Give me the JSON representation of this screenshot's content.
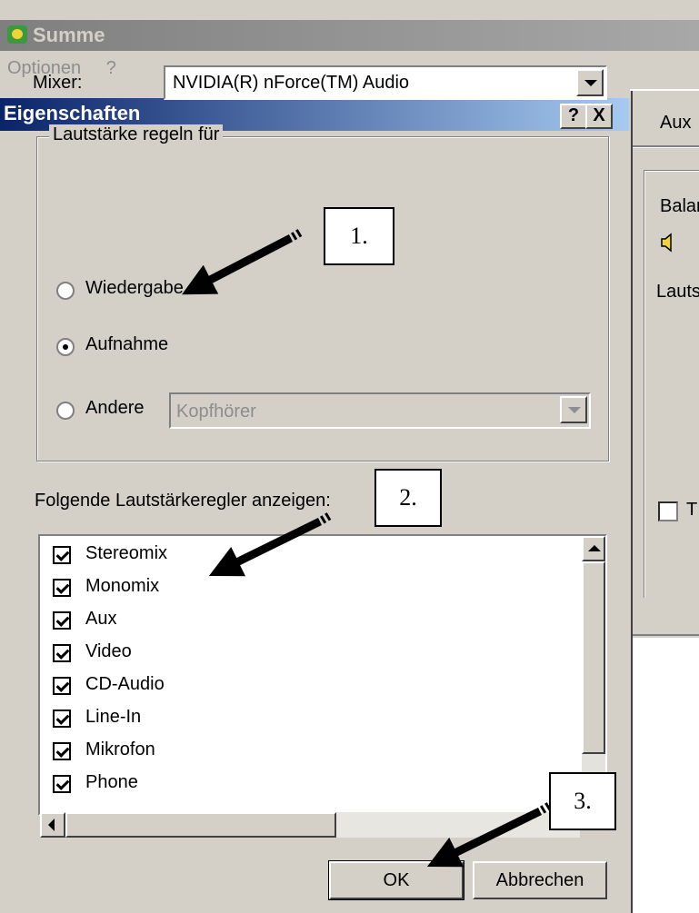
{
  "parent_window": {
    "title": "Summe",
    "menu": [
      "Optionen",
      "?"
    ]
  },
  "right_panel": {
    "tab": "Aux",
    "balance": "Balan",
    "volume": "Lauts",
    "checkbox_label": "T"
  },
  "dialog": {
    "title": "Eigenschaften",
    "help_button": "?",
    "close_button": "X",
    "mixer_label": "Mixer:",
    "mixer_value": "NVIDIA(R) nForce(TM) Audio",
    "group_label": "Lautstärke regeln für",
    "radios": [
      {
        "label": "Wiedergabe",
        "selected": false
      },
      {
        "label": "Aufnahme",
        "selected": true
      },
      {
        "label": "Andere",
        "selected": false
      }
    ],
    "andere_value": "Kopfhörer",
    "show_label": "Folgende Lautstärkeregler anzeigen:",
    "controls": [
      {
        "label": "Stereomix",
        "checked": true
      },
      {
        "label": "Monomix",
        "checked": true
      },
      {
        "label": "Aux",
        "checked": true
      },
      {
        "label": "Video",
        "checked": true
      },
      {
        "label": "CD-Audio",
        "checked": true
      },
      {
        "label": "Line-In",
        "checked": true
      },
      {
        "label": "Mikrofon",
        "checked": true
      },
      {
        "label": "Phone",
        "checked": true
      }
    ],
    "ok_label": "OK",
    "cancel_label": "Abbrechen"
  },
  "annotations": {
    "step1": "1.",
    "step2": "2.",
    "step3": "3."
  },
  "colors": {
    "title_active_start": "#0a246a",
    "title_active_end": "#a6caf0",
    "face": "#d4d0c8"
  }
}
